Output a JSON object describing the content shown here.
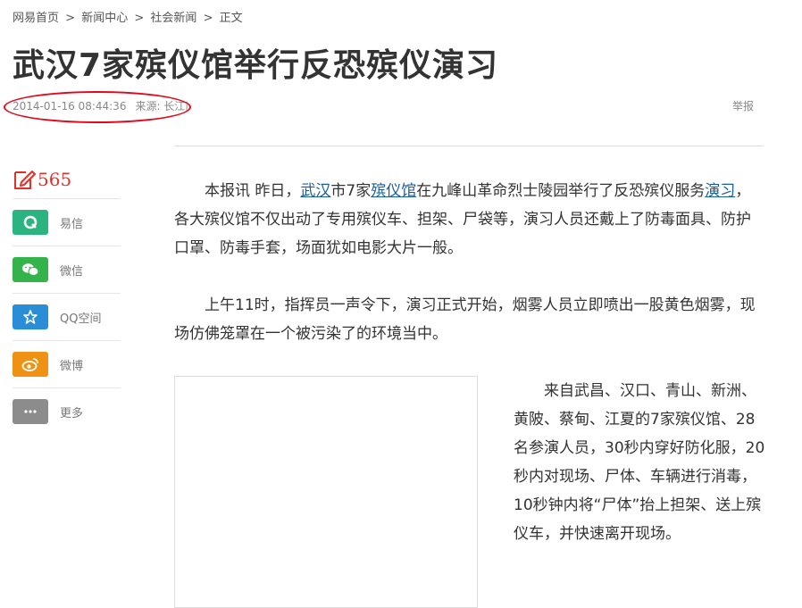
{
  "breadcrumb": {
    "home": "网易首页",
    "news_center": "新闻中心",
    "social_news": "社会新闻",
    "current": "正文",
    "separator": ">"
  },
  "article": {
    "title": "武汉7家殡仪馆举行反恐殡仪演习",
    "date": "2014-01-16 08:44:36",
    "source": "来源: 长江商报",
    "report": "举报"
  },
  "sidebar": {
    "comment_count": "565",
    "share": [
      {
        "label": "易信",
        "icon": "yixin-icon",
        "color": "#2bb380"
      },
      {
        "label": "微信",
        "icon": "wechat-icon",
        "color": "#33b34a"
      },
      {
        "label": "QQ空间",
        "icon": "qzone-icon",
        "color": "#2a8ed6"
      },
      {
        "label": "微博",
        "icon": "weibo-icon",
        "color": "#ef9113"
      },
      {
        "label": "更多",
        "icon": "more-icon",
        "color": "#8c8c8c"
      }
    ]
  },
  "body": {
    "p1": {
      "a": "本报讯 昨日，",
      "link1": "武汉",
      "b": "市7家",
      "link2": "殡仪馆",
      "c": "在九峰山革命烈士陵园举行了反恐殡仪服务",
      "link3": "演习",
      "d": "，各大殡仪馆不仅出动了专用殡仪车、担架、尸袋等，演习人员还戴上了防毒面具、防护口罩、防毒手套，场面犹如电影大片一般。"
    },
    "p2": "上午11时，指挥员一声令下，演习正式开始，烟雾人员立即喷出一股黄色烟雾，现场仿佛笼罩在一个被污染了的环境当中。",
    "p3": "来自武昌、汉口、青山、新洲、黄陂、蔡甸、江夏的7家殡仪馆、28名参演人员，30秒内穿好防化服，20秒内对现场、尸体、车辆进行消毒，10秒钟内将“尸体”抬上担架、送上殡仪车，并快速离开现场。"
  },
  "colors": {
    "accent_red": "#e2071a",
    "link_blue": "#1a5d9e"
  }
}
